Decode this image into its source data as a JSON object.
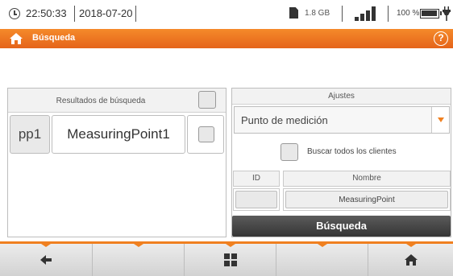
{
  "status_bar": {
    "time": "22:50:33",
    "date": "2018-07-20",
    "storage": "1.8 GB",
    "battery": "100 %",
    "icons": [
      "clock-icon",
      "sd-card-icon",
      "signal-icon",
      "battery-icon",
      "plug-icon"
    ]
  },
  "title_bar": {
    "title": "Búsqueda",
    "icons": [
      "home-icon",
      "help-icon"
    ],
    "help_glyph": "?"
  },
  "results": {
    "header": "Resultados de búsqueda",
    "rows": [
      {
        "id": "pp1",
        "name": "MeasuringPoint1",
        "checked": false
      }
    ]
  },
  "settings": {
    "header": "Ajustes",
    "select_value": "Punto de medición",
    "search_all_label": "Buscar todos los clientes",
    "search_all_checked": false,
    "id_header": "ID",
    "name_header": "Nombre",
    "id_value": "",
    "name_value": "MeasuringPoint",
    "search_button": "Búsqueda"
  },
  "bottom_nav": {
    "buttons": [
      "back-arrow-icon",
      "",
      "grid-icon",
      "",
      "home-icon"
    ]
  },
  "colors": {
    "accent": "#f08020",
    "dark_button": "#3f3f3f"
  }
}
